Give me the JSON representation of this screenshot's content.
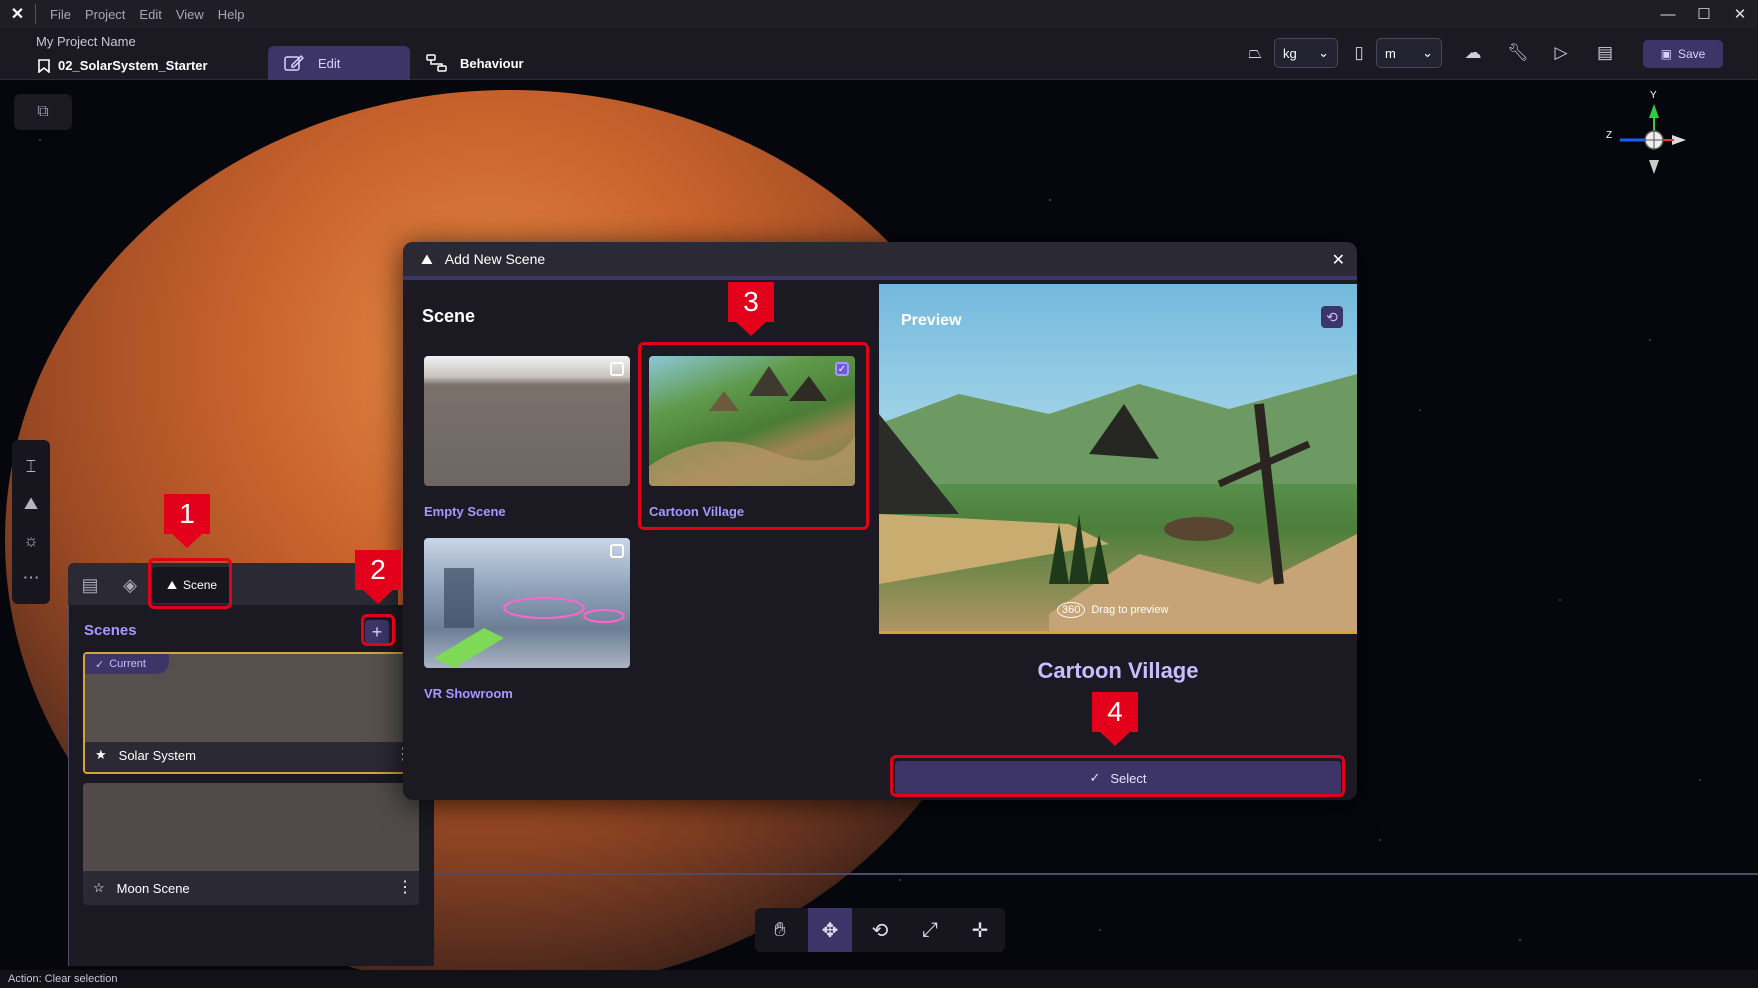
{
  "titlebar": {
    "menu": [
      "File",
      "Project",
      "Edit",
      "View",
      "Help"
    ]
  },
  "header": {
    "project_name": "My Project Name",
    "scene_file": "02_SolarSystem_Starter",
    "tab_edit": "Edit",
    "tab_behaviour": "Behaviour",
    "mass_unit": "kg",
    "length_unit": "m",
    "save_label": "Save"
  },
  "panel": {
    "scene_tab_label": "Scene",
    "title": "Scenes",
    "current_badge": "Current",
    "scenes": [
      {
        "name": "Solar System"
      },
      {
        "name": "Moon Scene"
      }
    ]
  },
  "dialog": {
    "title": "Add New Scene",
    "list_title": "Scene",
    "templates": [
      {
        "name": "Empty Scene"
      },
      {
        "name": "Cartoon Village"
      },
      {
        "name": "VR Showroom"
      }
    ],
    "preview_label": "Preview",
    "preview_hint_badge": "360",
    "preview_hint": "Drag to preview",
    "preview_name": "Cartoon Village",
    "select_label": "Select"
  },
  "axis": {
    "y": "Y",
    "z": "Z"
  },
  "status_bar": "Action: Clear selection",
  "callouts": [
    "1",
    "2",
    "3",
    "4"
  ],
  "colors": {
    "accent": "#3d3568",
    "accent_text": "#a598ff",
    "highlight": "#e2001a",
    "selected_border": "#d6a23a"
  }
}
